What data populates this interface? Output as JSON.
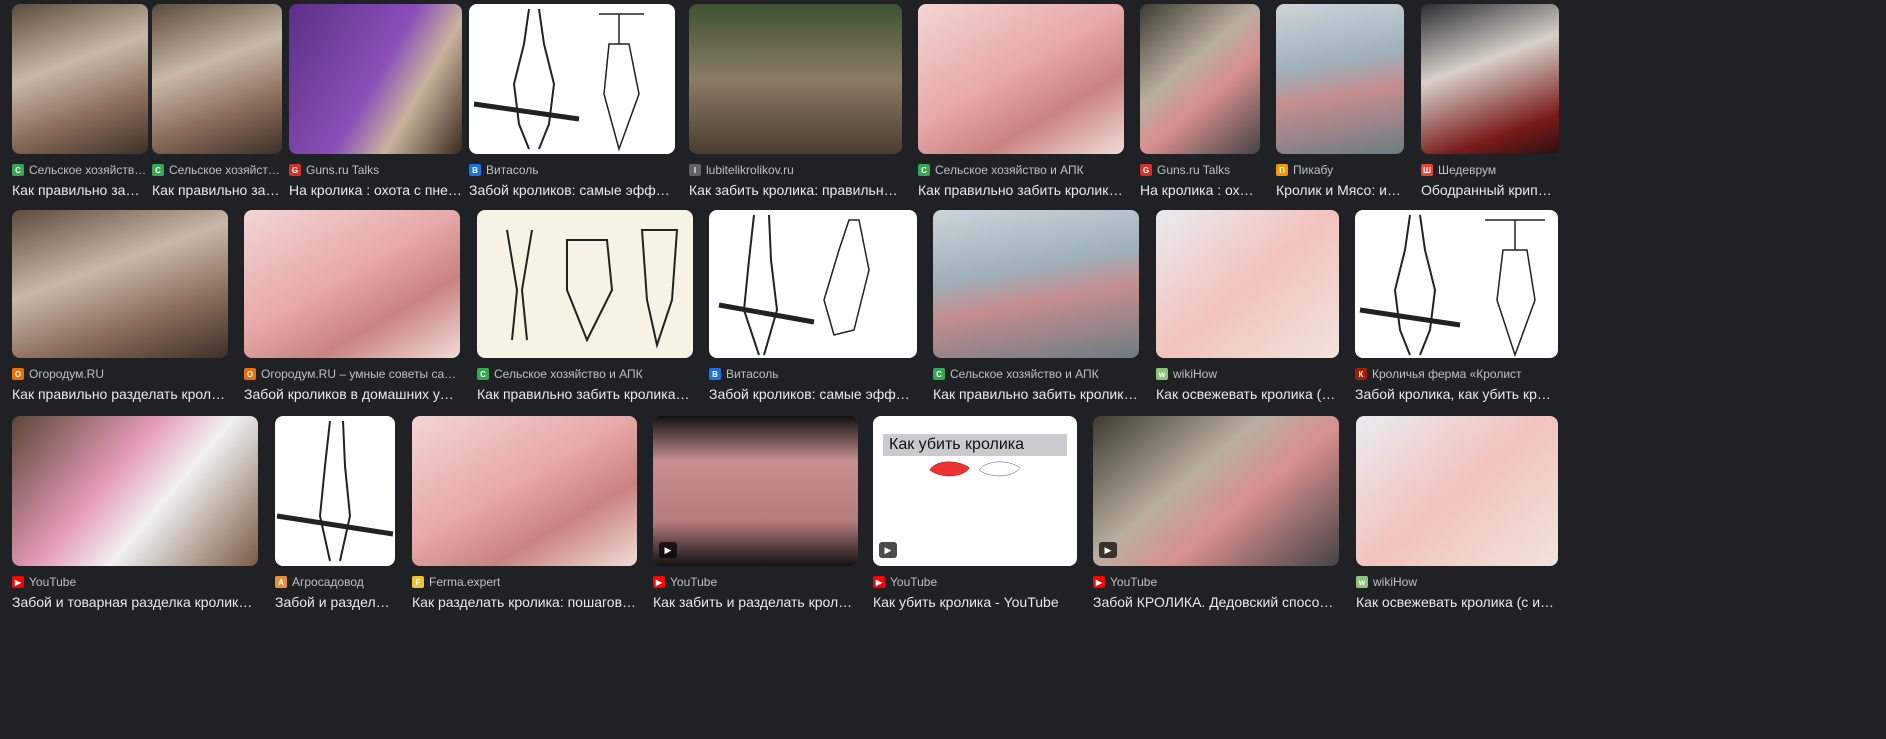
{
  "results": [
    {
      "source": "Сельское хозяйств…",
      "title": "Как правильно за…",
      "fav_color": "#34a853",
      "fav": "С"
    },
    {
      "source": "Сельское хозяйств…",
      "title": "Как правильно за…",
      "fav_color": "#34a853",
      "fav": "С"
    },
    {
      "source": "Guns.ru Talks",
      "title": "На кролика : охота с пнев…",
      "fav_color": "#d93025",
      "fav": "G"
    },
    {
      "source": "Витасоль",
      "title": "Забой кроликов: самые эффекти…",
      "fav_color": "#1a73e8",
      "fav": "В"
    },
    {
      "source": "lubitelikrolikov.ru",
      "title": "Как забить кролика: правильно, в …",
      "fav_color": "#5f6368",
      "fav": "l"
    },
    {
      "source": "Сельское хозяйство и АПК",
      "title": "Как правильно забить кролика - …",
      "fav_color": "#34a853",
      "fav": "С"
    },
    {
      "source": "Guns.ru Talks",
      "title": "На кролика : охот…",
      "fav_color": "#d93025",
      "fav": "G"
    },
    {
      "source": "Пикабу",
      "title": "Кролик и Мясо: ист…",
      "fav_color": "#f29900",
      "fav": "П"
    },
    {
      "source": "Шедеврум",
      "title": "Ободранный крипов…",
      "fav_color": "#ea4335",
      "fav": "Ш"
    },
    {
      "source": "Огородум.RU",
      "title": "Как правильно разделать кролика …",
      "fav_color": "#e8710a",
      "fav": "О"
    },
    {
      "source": "Огородум.RU – умные советы садовод…",
      "title": "Забой кроликов в домашних услов…",
      "fav_color": "#e8710a",
      "fav": "О"
    },
    {
      "source": "Сельское хозяйство и АПК",
      "title": "Как правильно забить кролика - по…",
      "fav_color": "#34a853",
      "fav": "С"
    },
    {
      "source": "Витасоль",
      "title": "Забой кроликов: самые эффектив…",
      "fav_color": "#1a73e8",
      "fav": "В"
    },
    {
      "source": "Сельское хозяйство и АПК",
      "title": "Как правильно забить кролика - …",
      "fav_color": "#34a853",
      "fav": "С"
    },
    {
      "source": "wikiHow",
      "title": "Как освежевать кролика (с ил…",
      "fav_color": "#93c47d",
      "fav": "w"
    },
    {
      "source": "Кроличья ферма «Кролист",
      "title": "Забой кролика, как убить кролик…",
      "fav_color": "#a61c00",
      "fav": "К"
    },
    {
      "source": "YouTube",
      "title": "Забой и товарная разделка кроликов за …",
      "fav_color": "#ff0000",
      "fav": "▶"
    },
    {
      "source": "Агросадовод",
      "title": "Забой и разделка …",
      "fav_color": "#e69138",
      "fav": "А"
    },
    {
      "source": "Ferma.expert",
      "title": "Как разделать кролика: пошаговые и…",
      "fav_color": "#f1c232",
      "fav": "F"
    },
    {
      "source": "YouTube",
      "title": "Как забить и разделать кролика …",
      "fav_color": "#ff0000",
      "fav": "▶"
    },
    {
      "source": "YouTube",
      "title": "Как убить кролика - YouTube",
      "fav_color": "#ff0000",
      "fav": "▶",
      "overlay": "Как убить кролика"
    },
    {
      "source": "YouTube",
      "title": "Забой КРОЛИКА. Дедовский способ. - Yo…",
      "fav_color": "#ff0000",
      "fav": "▶"
    },
    {
      "source": "wikiHow",
      "title": "Как освежевать кролика (с иллю…",
      "fav_color": "#93c47d",
      "fav": "w"
    }
  ]
}
